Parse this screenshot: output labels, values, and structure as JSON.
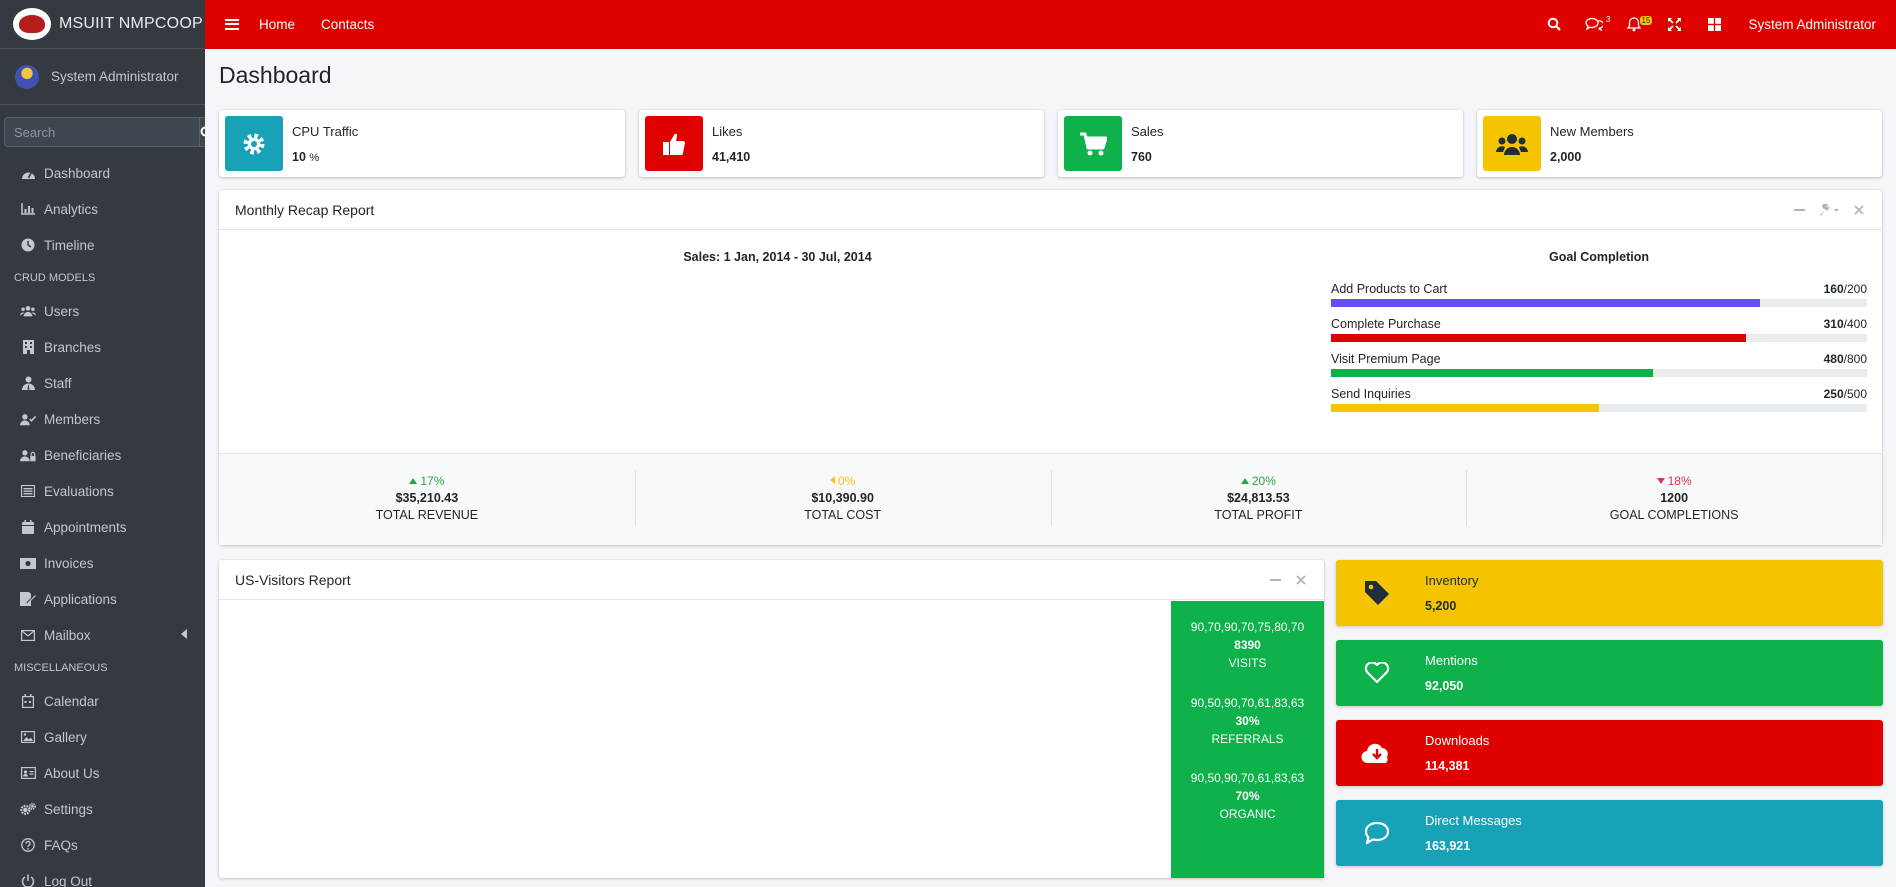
{
  "brand": {
    "name": "MSUIIT NMPCOOP"
  },
  "user": {
    "name": "System Administrator"
  },
  "search": {
    "placeholder": "Search"
  },
  "sidebar": {
    "items_top": [
      "Dashboard",
      "Analytics",
      "Timeline"
    ],
    "header_crud": "CRUD MODELS",
    "items_crud": [
      "Users",
      "Branches",
      "Staff",
      "Members",
      "Beneficiaries",
      "Evaluations",
      "Appointments",
      "Invoices",
      "Applications",
      "Mailbox"
    ],
    "header_misc": "MISCELLANEOUS",
    "items_misc": [
      "Calendar",
      "Gallery",
      "About Us",
      "Settings",
      "FAQs",
      "Log Out"
    ]
  },
  "topbar": {
    "links": [
      "Home",
      "Contacts"
    ],
    "messages_count": "3",
    "notifications_count": "15",
    "user": "System Administrator",
    "color": "#e00000"
  },
  "page": {
    "title": "Dashboard"
  },
  "info_boxes": [
    {
      "text": "CPU Traffic",
      "number": "10",
      "unit": "%",
      "icon": "gear-icon",
      "color": "#17a2b8"
    },
    {
      "text": "Likes",
      "number": "41,410",
      "icon": "thumbs-up-icon",
      "color": "#e00000"
    },
    {
      "text": "Sales",
      "number": "760",
      "icon": "cart-icon",
      "color": "#0eb14a"
    },
    {
      "text": "New Members",
      "number": "2,000",
      "icon": "users-icon",
      "color": "#f5c400"
    }
  ],
  "recap": {
    "title": "Monthly Recap Report",
    "chart_title": "Sales: 1 Jan, 2014 - 30 Jul, 2014",
    "goal_title": "Goal Completion",
    "goals": [
      {
        "label": "Add Products to Cart",
        "value": "160",
        "total": "/200",
        "fraction": 0.8,
        "color": "#6251ee"
      },
      {
        "label": "Complete Purchase",
        "value": "310",
        "total": "/400",
        "fraction": 0.775,
        "color": "#e00000"
      },
      {
        "label": "Visit Premium Page",
        "value": "480",
        "total": "/800",
        "fraction": 0.6,
        "color": "#0eb14a"
      },
      {
        "label": "Send Inquiries",
        "value": "250",
        "total": "/500",
        "fraction": 0.5,
        "color": "#f5c400"
      }
    ],
    "stats": [
      {
        "pct": "17%",
        "trend": "up",
        "amount": "$35,210.43",
        "label": "TOTAL REVENUE",
        "color": "#28a745"
      },
      {
        "pct": "0%",
        "trend": "flat",
        "amount": "$10,390.90",
        "label": "TOTAL COST",
        "color": "#ffc107"
      },
      {
        "pct": "20%",
        "trend": "up",
        "amount": "$24,813.53",
        "label": "TOTAL PROFIT",
        "color": "#28a745"
      },
      {
        "pct": "18%",
        "trend": "down",
        "amount": "1200",
        "label": "GOAL COMPLETIONS",
        "color": "#dc3545"
      }
    ]
  },
  "visitors": {
    "title": "US-Visitors Report",
    "blocks": [
      {
        "spark": "90,70,90,70,75,80,70",
        "value": "8390",
        "label": "VISITS"
      },
      {
        "spark": "90,50,90,70,61,83,63",
        "value": "30%",
        "label": "REFERRALS"
      },
      {
        "spark": "90,50,90,70,61,83,63",
        "value": "70%",
        "label": "ORGANIC"
      }
    ],
    "color": "#0eb14a"
  },
  "small_boxes": [
    {
      "title": "Inventory",
      "number": "5,200",
      "icon": "tag-icon",
      "color": "#f5c400",
      "text_color": "#1f2d3d"
    },
    {
      "title": "Mentions",
      "number": "92,050",
      "icon": "heart-icon",
      "color": "#0eb14a",
      "text_color": "#ffffff"
    },
    {
      "title": "Downloads",
      "number": "114,381",
      "icon": "cloud-download-icon",
      "color": "#e00000",
      "text_color": "#ffffff"
    },
    {
      "title": "Direct Messages",
      "number": "163,921",
      "icon": "comment-icon",
      "color": "#17a2b8",
      "text_color": "#ffffff"
    }
  ]
}
